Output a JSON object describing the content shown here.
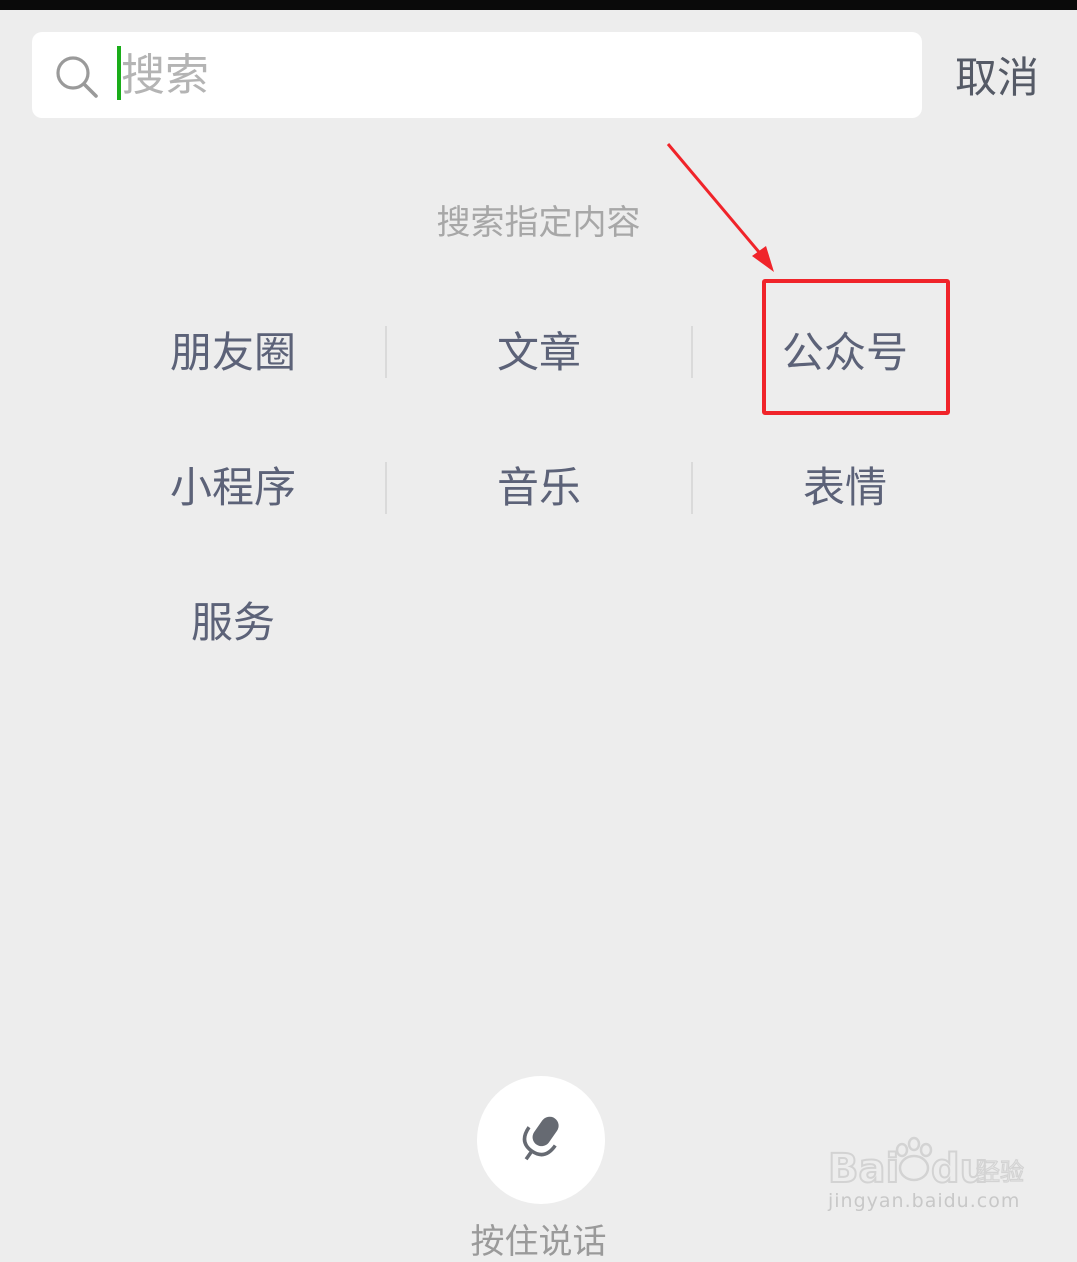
{
  "search": {
    "placeholder": "搜索",
    "value": "",
    "cancel_label": "取消"
  },
  "section_title": "搜索指定内容",
  "categories": [
    {
      "label": "朋友圈"
    },
    {
      "label": "文章"
    },
    {
      "label": "公众号"
    },
    {
      "label": "小程序"
    },
    {
      "label": "音乐"
    },
    {
      "label": "表情"
    },
    {
      "label": "服务"
    }
  ],
  "voice": {
    "label": "按住说话"
  },
  "annotation": {
    "highlight_color": "#f0242a",
    "highlighted_item": "公众号"
  },
  "watermark": {
    "brand": "Baidu经验",
    "domain": "jingyan.baidu.com"
  },
  "colors": {
    "background": "#ededed",
    "caret": "#1aad19",
    "category_text": "#5c6278",
    "section_text": "#a7a7a7"
  }
}
